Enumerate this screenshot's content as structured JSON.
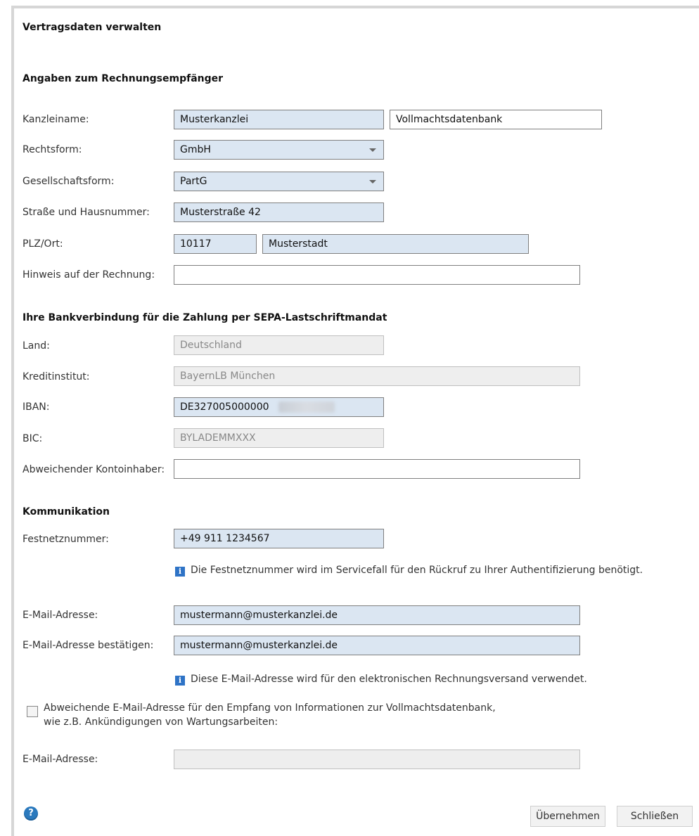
{
  "dialog": {
    "title": "Vertragsdaten verwalten"
  },
  "billing": {
    "heading": "Angaben zum Rechnungsempfänger",
    "firm_name_label": "Kanzleiname:",
    "firm_name_value": "Musterkanzlei",
    "firm_name_extra_value": "Vollmachtsdatenbank",
    "legal_form_label": "Rechtsform:",
    "legal_form_value": "GmbH",
    "company_form_label": "Gesellschaftsform:",
    "company_form_value": "PartG",
    "street_label": "Straße und Hausnummer:",
    "street_value": "Musterstraße 42",
    "zip_city_label": "PLZ/Ort:",
    "zip_value": "10117",
    "city_value": "Musterstadt",
    "invoice_note_label": "Hinweis auf der Rechnung:",
    "invoice_note_value": ""
  },
  "bank": {
    "heading": "Ihre Bankverbindung für die Zahlung per SEPA-Lastschriftmandat",
    "country_label": "Land:",
    "country_value": "Deutschland",
    "bank_label": "Kreditinstitut:",
    "bank_value": "BayernLB München",
    "iban_label": "IBAN:",
    "iban_value": "DE327005000000",
    "bic_label": "BIC:",
    "bic_value": "BYLADEMMXXX",
    "account_holder_label": "Abweichender Kontoinhaber:",
    "account_holder_value": ""
  },
  "communication": {
    "heading": "Kommunikation",
    "phone_label": "Festnetznummer:",
    "phone_value": "+49 911 1234567",
    "phone_info": "Die Festnetznummer wird im Servicefall für den Rückruf zu Ihrer Authentifizierung benötigt.",
    "email_label": "E-Mail-Adresse:",
    "email_value": "mustermann@musterkanzlei.de",
    "email_confirm_label": "E-Mail-Adresse bestätigen:",
    "email_confirm_value": "mustermann@musterkanzlei.de",
    "email_info": "Diese E-Mail-Adresse wird für den elektronischen Rechnungsversand verwendet.",
    "alt_email_checkbox_line1": "Abweichende E-Mail-Adresse für den Empfang von Informationen zur Vollmachtsdatenbank,",
    "alt_email_checkbox_line2": "wie z.B. Ankündigungen von Wartungsarbeiten:",
    "alt_email_label": "E-Mail-Adresse:",
    "alt_email_value": ""
  },
  "footer": {
    "help_icon_glyph": "?",
    "apply_label": "Übernehmen",
    "close_label": "Schließen"
  },
  "icons": {
    "info_icon_glyph": "i"
  }
}
